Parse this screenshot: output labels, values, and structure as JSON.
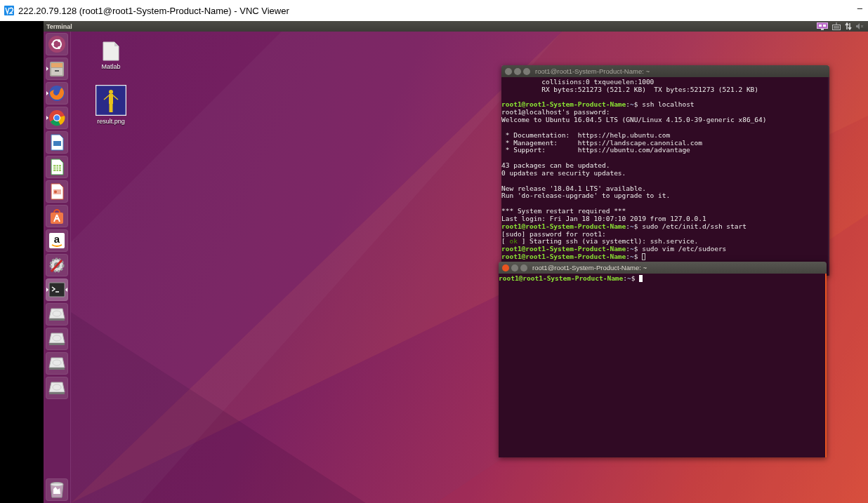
{
  "vnc": {
    "title": "222.20.79.128 (root1@root1-System-Product-Name) - VNC Viewer",
    "minimize": "–"
  },
  "top_panel": {
    "app_name": "Terminal",
    "indicators": [
      {
        "kind": "display"
      },
      {
        "kind": "keyboard"
      },
      {
        "kind": "network"
      },
      {
        "kind": "sound",
        "muted": true
      }
    ]
  },
  "launcher": {
    "items": [
      {
        "kind": "dash",
        "running": false,
        "focused": false
      },
      {
        "kind": "files",
        "running": true,
        "focused": false
      },
      {
        "kind": "firefox",
        "running": true,
        "focused": false
      },
      {
        "kind": "chrome",
        "running": true,
        "focused": false
      },
      {
        "kind": "writer",
        "running": false,
        "focused": false
      },
      {
        "kind": "calc",
        "running": false,
        "focused": false
      },
      {
        "kind": "impress",
        "running": false,
        "focused": false
      },
      {
        "kind": "store",
        "running": false,
        "focused": false
      },
      {
        "kind": "amazon",
        "glyph": "a",
        "running": false,
        "focused": false
      },
      {
        "kind": "settings",
        "running": false,
        "focused": false
      },
      {
        "kind": "terminal",
        "running": true,
        "focused": true
      },
      {
        "kind": "drive",
        "running": false,
        "focused": false
      },
      {
        "kind": "drive",
        "running": false,
        "focused": false
      },
      {
        "kind": "drive",
        "running": false,
        "focused": false
      },
      {
        "kind": "drive",
        "running": false,
        "focused": false
      }
    ],
    "trash": {
      "kind": "trash",
      "running": false,
      "focused": false
    }
  },
  "desktop_icons": [
    {
      "kind": "file",
      "label": "Matlab"
    },
    {
      "kind": "picture",
      "label": "result.png"
    }
  ],
  "terminals": [
    {
      "title": "root1@root1-System-Product-Name: ~",
      "focused": false,
      "lines": [
        {
          "kind": "text",
          "parts": [
            {
              "kind": "plain",
              "text": "          collisions:0 txqueuelen:1000"
            }
          ]
        },
        {
          "kind": "text",
          "parts": [
            {
              "kind": "plain",
              "text": "          RX bytes:521273 (521.2 KB)  TX bytes:521273 (521.2 KB)"
            }
          ]
        },
        {
          "kind": "blank"
        },
        {
          "kind": "text",
          "parts": [
            {
              "kind": "user",
              "text": "root1@root1-System-Product-Name"
            },
            {
              "kind": "plain",
              "text": ":"
            },
            {
              "kind": "path",
              "text": "~"
            },
            {
              "kind": "plain",
              "text": "$ ssh localhost"
            }
          ]
        },
        {
          "kind": "text",
          "parts": [
            {
              "kind": "plain",
              "text": "root1@localhost's password:"
            }
          ]
        },
        {
          "kind": "text",
          "parts": [
            {
              "kind": "plain",
              "text": "Welcome to Ubuntu 16.04.5 LTS (GNU/Linux 4.15.0-39-generic x86_64)"
            }
          ]
        },
        {
          "kind": "blank"
        },
        {
          "kind": "text",
          "parts": [
            {
              "kind": "plain",
              "text": " * Documentation:  https://help.ubuntu.com"
            }
          ]
        },
        {
          "kind": "text",
          "parts": [
            {
              "kind": "plain",
              "text": " * Management:     https://landscape.canonical.com"
            }
          ]
        },
        {
          "kind": "text",
          "parts": [
            {
              "kind": "plain",
              "text": " * Support:        https://ubuntu.com/advantage"
            }
          ]
        },
        {
          "kind": "blank"
        },
        {
          "kind": "text",
          "parts": [
            {
              "kind": "plain",
              "text": "43 packages can be updated."
            }
          ]
        },
        {
          "kind": "text",
          "parts": [
            {
              "kind": "plain",
              "text": "0 updates are security updates."
            }
          ]
        },
        {
          "kind": "blank"
        },
        {
          "kind": "text",
          "parts": [
            {
              "kind": "plain",
              "text": "New release '18.04.1 LTS' available."
            }
          ]
        },
        {
          "kind": "text",
          "parts": [
            {
              "kind": "plain",
              "text": "Run 'do-release-upgrade' to upgrade to it."
            }
          ]
        },
        {
          "kind": "blank"
        },
        {
          "kind": "text",
          "parts": [
            {
              "kind": "plain",
              "text": "*** System restart required ***"
            }
          ]
        },
        {
          "kind": "text",
          "parts": [
            {
              "kind": "plain",
              "text": "Last login: Fri Jan 18 10:07:10 2019 from 127.0.0.1"
            }
          ]
        },
        {
          "kind": "text",
          "parts": [
            {
              "kind": "user",
              "text": "root1@root1-System-Product-Name"
            },
            {
              "kind": "plain",
              "text": ":"
            },
            {
              "kind": "path",
              "text": "~"
            },
            {
              "kind": "plain",
              "text": "$ sudo /etc/init.d/ssh start"
            }
          ]
        },
        {
          "kind": "text",
          "parts": [
            {
              "kind": "plain",
              "text": "[sudo] password for root1:"
            }
          ]
        },
        {
          "kind": "text",
          "parts": [
            {
              "kind": "plain",
              "text": "[ "
            },
            {
              "kind": "ok",
              "text": "ok"
            },
            {
              "kind": "plain",
              "text": " ] Starting ssh (via systemctl): ssh.service."
            }
          ]
        },
        {
          "kind": "text",
          "parts": [
            {
              "kind": "user",
              "text": "root1@root1-System-Product-Name"
            },
            {
              "kind": "plain",
              "text": ":"
            },
            {
              "kind": "path",
              "text": "~"
            },
            {
              "kind": "plain",
              "text": "$ sudo vim /etc/sudoers"
            }
          ]
        },
        {
          "kind": "text",
          "cursor": true,
          "parts": [
            {
              "kind": "user",
              "text": "root1@root1-System-Product-Name"
            },
            {
              "kind": "plain",
              "text": ":"
            },
            {
              "kind": "path",
              "text": "~"
            },
            {
              "kind": "plain",
              "text": "$ "
            }
          ]
        }
      ]
    },
    {
      "title": "root1@root1-System-Product-Name: ~",
      "focused": true,
      "lines": [
        {
          "kind": "text",
          "cursor": true,
          "parts": [
            {
              "kind": "user",
              "text": "root1@root1-System-Product-Name"
            },
            {
              "kind": "plain",
              "text": ":"
            },
            {
              "kind": "path",
              "text": "~"
            },
            {
              "kind": "plain",
              "text": "$ "
            }
          ]
        }
      ]
    }
  ]
}
